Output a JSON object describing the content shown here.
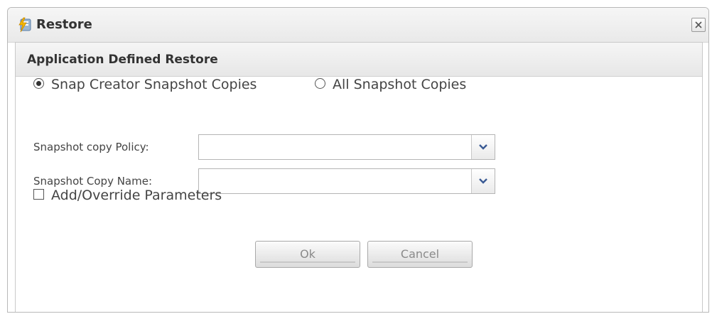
{
  "window": {
    "title": "Restore",
    "icon": "restore-app-icon",
    "close_icon": "close-icon"
  },
  "panel": {
    "title": "Application Defined Restore"
  },
  "source_options": [
    {
      "label": "Snap Creator Snapshot Copies",
      "selected": true
    },
    {
      "label": "All Snapshot Copies",
      "selected": false
    }
  ],
  "fields": {
    "policy": {
      "label": "Snapshot copy Policy:",
      "value": ""
    },
    "name": {
      "label": "Snapshot Copy Name:",
      "value": ""
    }
  },
  "add_override": {
    "label": "Add/Override Parameters",
    "checked": false
  },
  "buttons": {
    "ok": "Ok",
    "cancel": "Cancel"
  },
  "colors": {
    "dropdown_arrow": "#3a5a94"
  }
}
